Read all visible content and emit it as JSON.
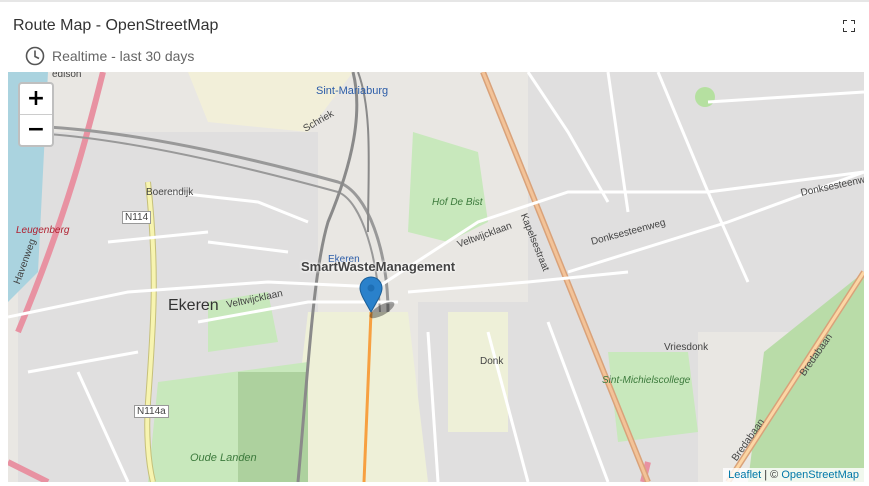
{
  "widget": {
    "title": "Route Map - OpenStreetMap",
    "time_window": "Realtime - last 30 days"
  },
  "map": {
    "zoom_in": "+",
    "zoom_out": "−",
    "marker_label": "SmartWasteManagement",
    "attribution": {
      "leaflet": "Leaflet",
      "separator": " | © ",
      "osm": "OpenStreetMap"
    },
    "place_labels": {
      "sint_mariaburg": "Sint-Mariaburg",
      "ekeren": "Ekeren",
      "boerendijk": "Boerendijk",
      "n114": "N114",
      "n114a": "N114a",
      "leugenberg": "Leugenberg",
      "havenweg": "Havenweg",
      "hof_de_bist": "Hof De Bist",
      "veltwijcklaan": "Veltwijcklaan",
      "kapelsestraat": "Kapelsestraat",
      "donksesteenweg": "Donksesteenweg",
      "vriesdonk": "Vriesdonk",
      "donk": "Donk",
      "sint_michielscollege": "Sint-Michielscollege",
      "oude_landen": "Oude Landen",
      "bredabaan": "Bredabaan",
      "schriek": "Schriek",
      "ekeren_station": "Ekeren",
      "edison": "edison"
    },
    "colors": {
      "route": "#f7a041",
      "marker": "#2a81cb",
      "park": "#c8e8bc",
      "water": "#aad3df",
      "primary_road": "#fcd6a4",
      "motorway": "#e892a2"
    }
  }
}
